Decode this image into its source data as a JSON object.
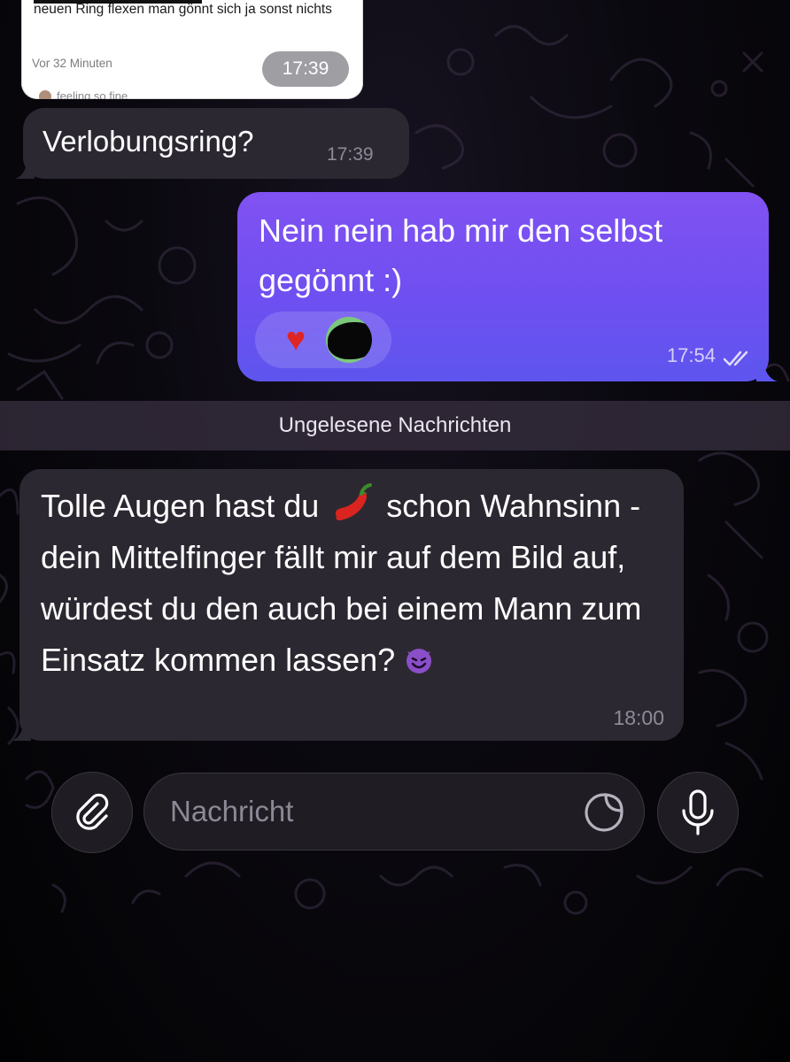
{
  "chat": {
    "reply_card": {
      "text": "Wollte kurz mit meinem neuen Ring flexen man gönnt sich ja sonst nichts",
      "time_ago": "Vor 32 Minuten",
      "time": "17:39",
      "next_line_partial": "feeling so fine"
    },
    "messages": [
      {
        "direction": "incoming",
        "text": "Verlobungsring?",
        "time": "17:39"
      },
      {
        "direction": "outgoing",
        "text": "Nein nein hab mir den selbst gegönnt :)",
        "time": "17:54",
        "reactions": [
          "heart",
          "avatar"
        ],
        "status": "read"
      },
      {
        "direction": "incoming",
        "text_before_chili": "Tolle Augen hast du",
        "text_after_chili": "schon Wahnsinn - dein Mittelfinger fällt mir auf dem Bild auf, würdest du den auch bei einem Mann zum Einsatz kommen lassen?",
        "time": "18:00",
        "emojis": [
          "chili-pepper",
          "smiling-devil"
        ]
      }
    ],
    "unread_divider": "Ungelesene Nachrichten"
  },
  "composer": {
    "placeholder": "Nachricht",
    "icons": {
      "attach": "paperclip-icon",
      "sticker": "sticker-icon",
      "mic": "microphone-icon"
    }
  },
  "colors": {
    "outgoing_bubble": "#7551f1",
    "incoming_bubble": "#2b2831",
    "background": "#0b0910"
  }
}
